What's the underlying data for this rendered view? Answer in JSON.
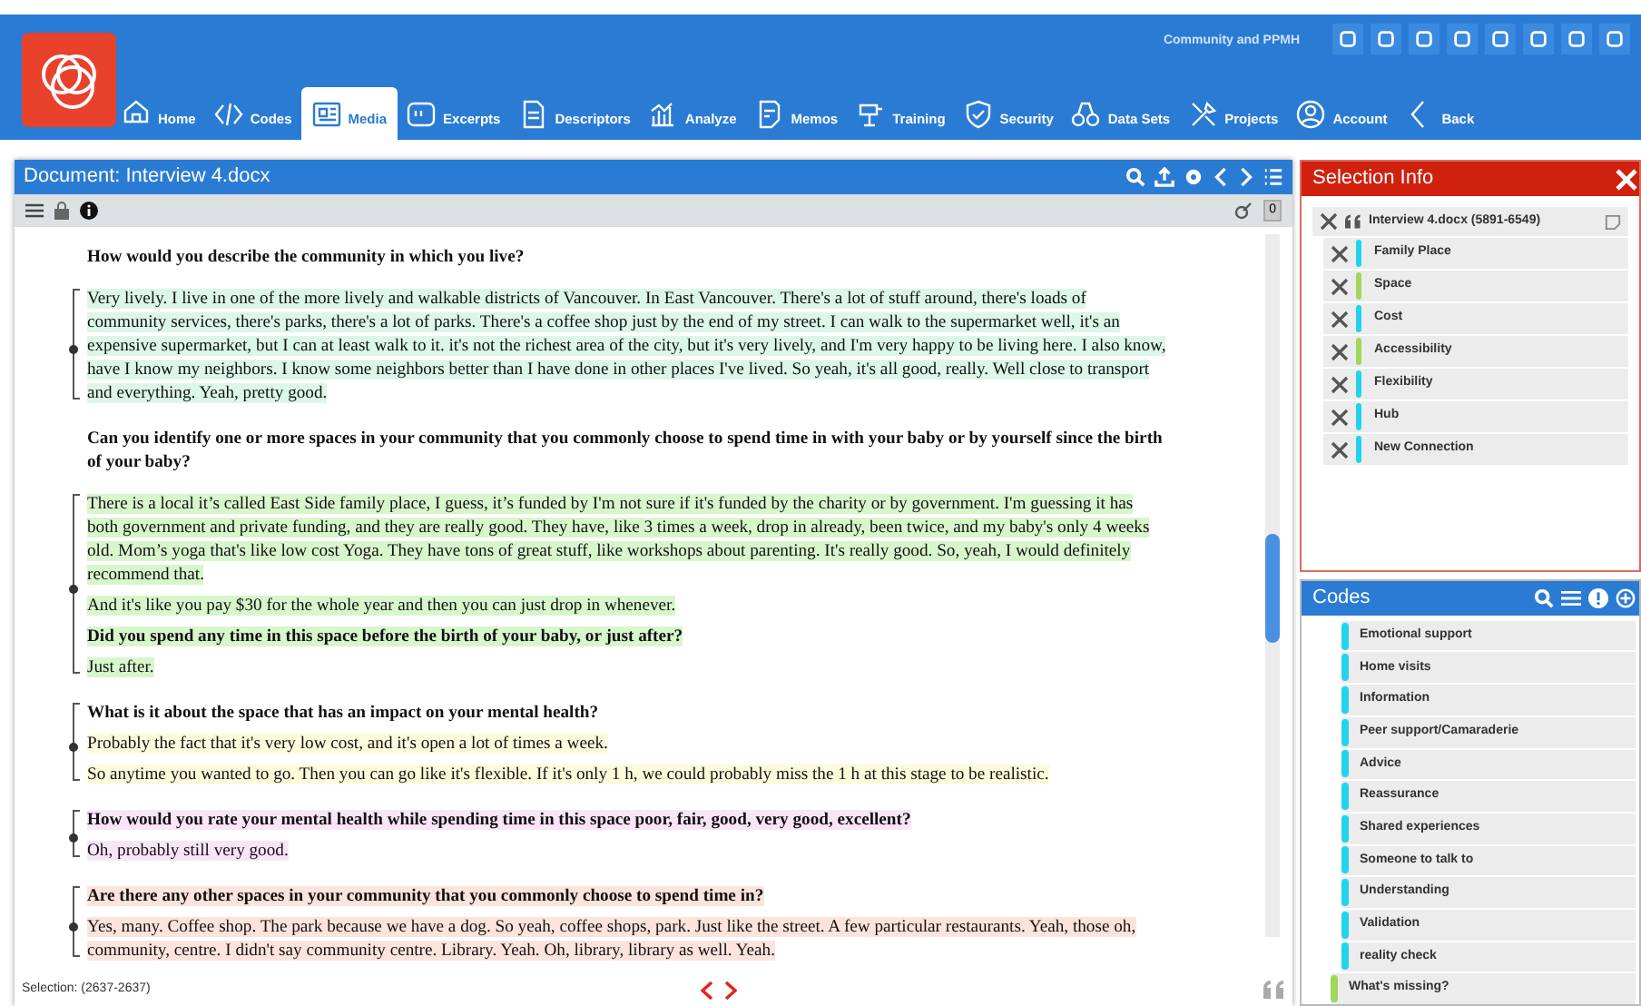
{
  "project": "Community and PPMH",
  "nav": [
    {
      "label": "Home",
      "selected": false
    },
    {
      "label": "Codes",
      "selected": false
    },
    {
      "label": "Media",
      "selected": true
    },
    {
      "label": "Excerpts",
      "selected": false
    },
    {
      "label": "Descriptors",
      "selected": false
    },
    {
      "label": "Analyze",
      "selected": false
    },
    {
      "label": "Memos",
      "selected": false
    },
    {
      "label": "Training",
      "selected": false
    },
    {
      "label": "Security",
      "selected": false
    },
    {
      "label": "Data Sets",
      "selected": false
    },
    {
      "label": "Projects",
      "selected": false
    },
    {
      "label": "Account",
      "selected": false
    },
    {
      "label": "Back",
      "selected": false
    }
  ],
  "document": {
    "title": "Document: Interview 4.docx",
    "counter": "0",
    "selection": "Selection: (2637-2637)",
    "items": [
      {
        "kind": "question",
        "text": "How would you describe the community in which you live?"
      },
      {
        "kind": "excerpt",
        "color": "#dcf7e8",
        "blocks": [
          {
            "kind": "answer",
            "highlighted": true,
            "text": "Very lively. I live in one of the more lively and walkable districts of Vancouver. In East Vancouver. There's a lot of stuff around, there's loads of community services, there's parks, there's a lot of parks. There's a coffee shop just by the end of my street. I can walk to the supermarket well, it's an expensive supermarket, but I can at least walk to it. it's not the richest area of the city, but it's very lively, and I'm very happy to be living here. I also know, have I know my neighbors. I know some neighbors better than I have done in other places I've lived. So yeah, it's all good, really. Well close to transport and everything. Yeah, pretty good."
          }
        ]
      },
      {
        "kind": "question",
        "text": "Can you identify one or more spaces in your community that you commonly choose to spend time in with your baby or by yourself since the birth of your baby?"
      },
      {
        "kind": "excerpt",
        "color": "#d8f6cc",
        "blocks": [
          {
            "kind": "answer",
            "highlighted": true,
            "text": "There is a local it’s called East Side family place, I guess, it’s funded by I'm not sure if it's funded by the charity or by government. I'm guessing it has both government and private funding, and they are really good. They have, like 3 times a week, drop in already, been twice, and my baby's only 4 weeks old. Mom’s yoga that's like low cost Yoga. They have tons of great stuff, like workshops about parenting. It's really good. So, yeah, I would definitely recommend that."
          },
          {
            "kind": "answer",
            "highlighted": true,
            "text": "And it's like you pay $30 for the whole year and then you can just drop in whenever."
          },
          {
            "kind": "question",
            "highlighted": true,
            "text": "Did you spend any time in this space before the birth of your baby, or just after?"
          },
          {
            "kind": "answer",
            "highlighted": true,
            "text": "Just after."
          }
        ]
      },
      {
        "kind": "excerpt",
        "color": "#fcfbdc",
        "blocks": [
          {
            "kind": "question",
            "highlighted": false,
            "text": "What is it about the space that has an impact on your mental health?"
          },
          {
            "kind": "answer",
            "highlighted": true,
            "text": "Probably the fact that it's very low cost, and it's open a lot of times a week."
          },
          {
            "kind": "answer",
            "highlighted": true,
            "text": "So anytime you wanted to go. Then you can go like it's flexible. If it's only 1 h, we could probably miss the 1 h at this stage to be realistic."
          }
        ]
      },
      {
        "kind": "excerpt",
        "color": "#f8e6f8",
        "blocks": [
          {
            "kind": "question",
            "highlighted": true,
            "text": "How would you rate your mental health while spending time in this space poor, fair, good, very good, excellent?"
          },
          {
            "kind": "answer",
            "highlighted": true,
            "text": "Oh, probably still very good."
          }
        ]
      },
      {
        "kind": "excerpt",
        "color": "#fce4dc",
        "blocks": [
          {
            "kind": "question",
            "highlighted": true,
            "text": "Are there any other spaces in your community that you commonly choose to spend time in?"
          },
          {
            "kind": "answer",
            "highlighted": true,
            "text": "Yes, many. Coffee shop. The park because we have a dog. So yeah, coffee shops, park. Just like the street. A few particular restaurants. Yeah, those oh, community, centre. I didn't say community centre. Library. Yeah. Oh, library, library as well. Yeah."
          }
        ]
      }
    ]
  },
  "selection_info": {
    "title": "Selection Info",
    "excerpt": "Interview 4.docx (5891-6549)",
    "codes": [
      {
        "label": "Family Place",
        "color": "#22d3ee"
      },
      {
        "label": "Space",
        "color": "#a3d65c"
      },
      {
        "label": "Cost",
        "color": "#22d3ee"
      },
      {
        "label": "Accessibility",
        "color": "#a3d65c"
      },
      {
        "label": "Flexibility",
        "color": "#22d3ee"
      },
      {
        "label": "Hub",
        "color": "#22d3ee"
      },
      {
        "label": "New Connection",
        "color": "#22d3ee"
      }
    ]
  },
  "codes": {
    "title": "Codes",
    "items": [
      {
        "label": "Emotional support",
        "color": "#22d3ee"
      },
      {
        "label": "Home visits",
        "color": "#22d3ee"
      },
      {
        "label": "Information",
        "color": "#22d3ee"
      },
      {
        "label": "Peer support/Camaraderie",
        "color": "#22d3ee"
      },
      {
        "label": "Advice",
        "color": "#22d3ee"
      },
      {
        "label": "Reassurance",
        "color": "#22d3ee"
      },
      {
        "label": "Shared experiences",
        "color": "#22d3ee"
      },
      {
        "label": "Someone to talk to",
        "color": "#22d3ee"
      },
      {
        "label": "Understanding",
        "color": "#22d3ee"
      },
      {
        "label": "Validation",
        "color": "#22d3ee"
      },
      {
        "label": "reality check",
        "color": "#22d3ee"
      },
      {
        "label": "What's missing?",
        "color": "#a3d65c",
        "kind": "parent"
      }
    ]
  }
}
